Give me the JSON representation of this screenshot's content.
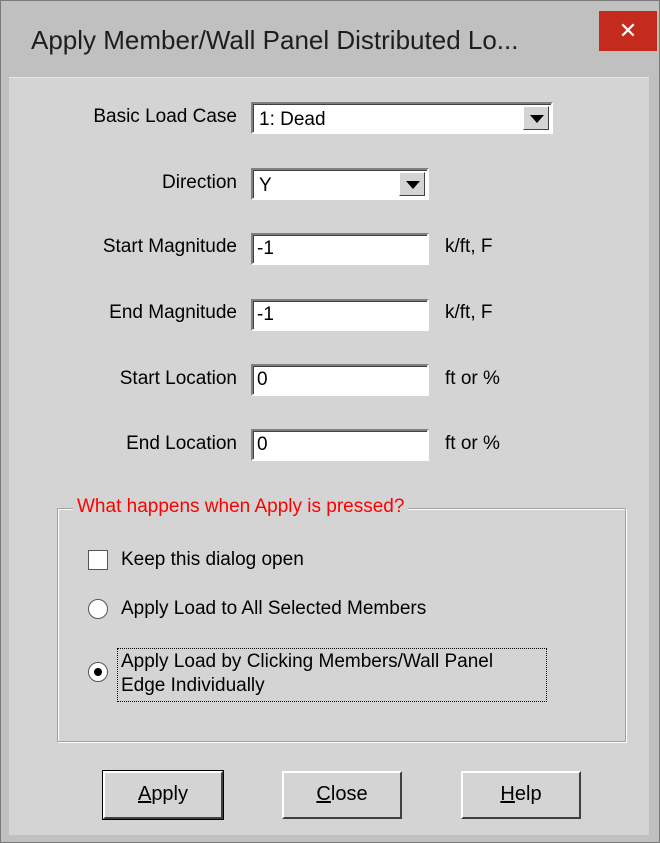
{
  "window": {
    "title": "Apply Member/Wall Panel Distributed Lo...",
    "close_glyph": "✕"
  },
  "form": {
    "basic_load_case": {
      "label": "Basic Load Case",
      "value": "1: Dead"
    },
    "direction": {
      "label": "Direction",
      "value": "Y"
    },
    "start_magnitude": {
      "label": "Start Magnitude",
      "value": "-1",
      "unit": "k/ft, F"
    },
    "end_magnitude": {
      "label": "End Magnitude",
      "value": "-1",
      "unit": "k/ft, F"
    },
    "start_location": {
      "label": "Start Location",
      "value": "0",
      "unit": "ft or %"
    },
    "end_location": {
      "label": "End Location",
      "value": "0",
      "unit": "ft or %"
    }
  },
  "group": {
    "legend": "What happens when Apply is pressed?",
    "legend_color": "#ff0000",
    "keep_open": {
      "label": "Keep this dialog open",
      "checked": false
    },
    "options": [
      {
        "label": "Apply Load to All Selected Members",
        "selected": false
      },
      {
        "label_line1": "Apply Load by Clicking Members/Wall Panel",
        "label_line2": "Edge Individually",
        "selected": true
      }
    ]
  },
  "buttons": {
    "apply": {
      "mnemonic": "A",
      "rest": "pply"
    },
    "close": {
      "mnemonic": "C",
      "rest": "lose"
    },
    "help": {
      "mnemonic": "H",
      "rest": "elp"
    }
  }
}
